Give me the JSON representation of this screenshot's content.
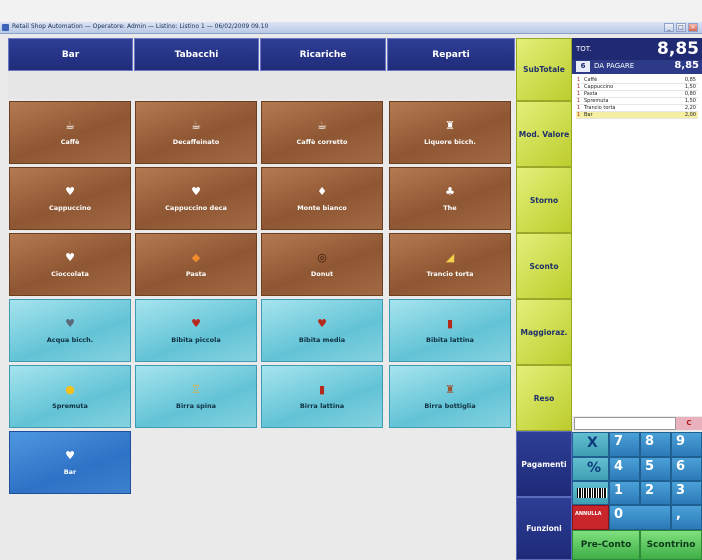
{
  "window": {
    "title": "Retail Shop Automation  —  Operatore: Admin  —  Listino: Listino 1  —  06/02/2009 09.10"
  },
  "categories": [
    "Bar",
    "Tabacchi",
    "Ricariche",
    "Reparti"
  ],
  "items": [
    {
      "label": "Caffè",
      "icon": "coffee-cup-icon",
      "glyph": "☕"
    },
    {
      "label": "Decaffeinato",
      "icon": "coffee-pot-icon",
      "glyph": "☕"
    },
    {
      "label": "Caffè corretto",
      "icon": "coffee-cup-icon",
      "glyph": "☕"
    },
    {
      "label": "Liquore bicch.",
      "icon": "liquor-bottle-icon",
      "glyph": "♜"
    },
    {
      "label": "Cappuccino",
      "icon": "cappuccino-cup-icon",
      "glyph": "♥"
    },
    {
      "label": "Cappuccino deca",
      "icon": "cappuccino-cup-icon",
      "glyph": "♥"
    },
    {
      "label": "Monte bianco",
      "icon": "dessert-cup-icon",
      "glyph": "♦"
    },
    {
      "label": "The",
      "icon": "teapot-icon",
      "glyph": "♣"
    },
    {
      "label": "Cioccolata",
      "icon": "chocolate-cup-icon",
      "glyph": "♥"
    },
    {
      "label": "Pasta",
      "icon": "pastry-icon",
      "glyph": "◆"
    },
    {
      "label": "Donut",
      "icon": "donut-icon",
      "glyph": "◎"
    },
    {
      "label": "Trancio torta",
      "icon": "cake-slice-icon",
      "glyph": "◢"
    },
    {
      "label": "Acqua bicch.",
      "icon": "water-glass-icon",
      "glyph": "♥"
    },
    {
      "label": "Bibita piccola",
      "icon": "soda-cup-icon",
      "glyph": "♥"
    },
    {
      "label": "Bibita media",
      "icon": "soda-cup-icon",
      "glyph": "♥"
    },
    {
      "label": "Bibita lattina",
      "icon": "soda-can-icon",
      "glyph": "▮"
    },
    {
      "label": "Spremuta",
      "icon": "juice-glass-icon",
      "glyph": "●"
    },
    {
      "label": "Birra spina",
      "icon": "beer-mug-icon",
      "glyph": "♖"
    },
    {
      "label": "Birra lattina",
      "icon": "beer-can-icon",
      "glyph": "▮"
    },
    {
      "label": "Birra bottiglia",
      "icon": "beer-bottle-icon",
      "glyph": "♜"
    },
    {
      "label": "Bar",
      "icon": "bar-glass-icon",
      "glyph": "♥"
    }
  ],
  "functions": [
    "SubTotale",
    "Mod. Valore",
    "Storno",
    "Sconto",
    "Maggioraz.",
    "Reso",
    "Pagamenti",
    "Funzioni"
  ],
  "totals": {
    "tot_label": "TOT.",
    "tot_value": "8,85",
    "count": "6",
    "pay_label": "DA PAGARE",
    "pay_value": "8,85"
  },
  "receipt": [
    {
      "qty": "1",
      "name": "Caffè",
      "price": "0,85"
    },
    {
      "qty": "1",
      "name": "Cappuccino",
      "price": "1,50"
    },
    {
      "qty": "1",
      "name": "Pasta",
      "price": "0,80"
    },
    {
      "qty": "1",
      "name": "Spremuta",
      "price": "1,50"
    },
    {
      "qty": "1",
      "name": "Trancio torta",
      "price": "2,20"
    },
    {
      "qty": "1",
      "name": "Bar",
      "price": "2,00"
    }
  ],
  "keypad": {
    "clear": "C",
    "x": "X",
    "percent": "%",
    "annulla": "ANNULLA",
    "digits": [
      "7",
      "8",
      "9",
      "4",
      "5",
      "6",
      "1",
      "2",
      "3",
      "0",
      ","
    ]
  },
  "actions": {
    "preconto": "Pre-Conto",
    "scontrino": "Scontrino"
  },
  "colors": {
    "navy": "#202c7a",
    "brown": "#8e5632",
    "cyan": "#62c3d6",
    "blue": "#2e72c6",
    "yellow": "#bccd2c",
    "green": "#3fae46",
    "red": "#c8262a"
  }
}
